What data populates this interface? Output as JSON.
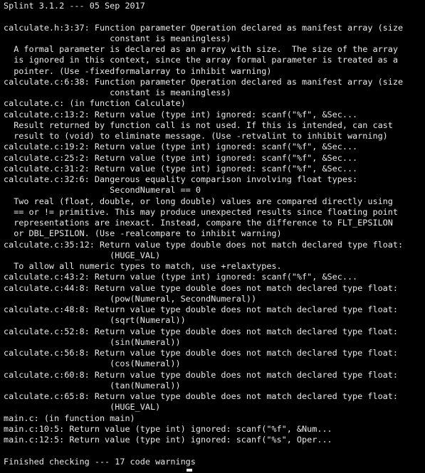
{
  "terminal": {
    "text_color": "#e8e8e8",
    "background_color": "#000000",
    "lines": [
      "Splint 3.1.2 --- 05 Sep 2017",
      "",
      "calculate.h:3:37: Function parameter Operation declared as manifest array (size",
      "                     constant is meaningless)",
      "  A formal parameter is declared as an array with size.  The size of the array",
      "  is ignored in this context, since the array formal parameter is treated as a",
      "  pointer. (Use -fixedformalarray to inhibit warning)",
      "calculate.c:6:38: Function parameter Operation declared as manifest array (size",
      "                     constant is meaningless)",
      "calculate.c: (in function Calculate)",
      "calculate.c:13:2: Return value (type int) ignored: scanf(\"%f\", &Sec...",
      "  Result returned by function call is not used. If this is intended, can cast",
      "  result to (void) to eliminate message. (Use -retvalint to inhibit warning)",
      "calculate.c:19:2: Return value (type int) ignored: scanf(\"%f\", &Sec...",
      "calculate.c:25:2: Return value (type int) ignored: scanf(\"%f\", &Sec...",
      "calculate.c:31:2: Return value (type int) ignored: scanf(\"%f\", &Sec...",
      "calculate.c:32:6: Dangerous equality comparison involving float types:",
      "                     SecondNumeral == 0",
      "  Two real (float, double, or long double) values are compared directly using",
      "  == or != primitive. This may produce unexpected results since floating point",
      "  representations are inexact. Instead, compare the difference to FLT_EPSILON",
      "  or DBL_EPSILON. (Use -realcompare to inhibit warning)",
      "calculate.c:35:12: Return value type double does not match declared type float:",
      "                     (HUGE_VAL)",
      "  To allow all numeric types to match, use +relaxtypes.",
      "calculate.c:43:2: Return value (type int) ignored: scanf(\"%f\", &Sec...",
      "calculate.c:44:8: Return value type double does not match declared type float:",
      "                     (pow(Numeral, SecondNumeral))",
      "calculate.c:48:8: Return value type double does not match declared type float:",
      "                     (sqrt(Numeral))",
      "calculate.c:52:8: Return value type double does not match declared type float:",
      "                     (sin(Numeral))",
      "calculate.c:56:8: Return value type double does not match declared type float:",
      "                     (cos(Numeral))",
      "calculate.c:60:8: Return value type double does not match declared type float:",
      "                     (tan(Numeral))",
      "calculate.c:65:8: Return value type double does not match declared type float:",
      "                     (HUGE_VAL)",
      "main.c: (in function main)",
      "main.c:10:5: Return value (type int) ignored: scanf(\"%f\", &Num...",
      "main.c:12:5: Return value (type int) ignored: scanf(\"%s\", Oper...",
      "",
      "Finished checking --- 17 code warnings"
    ]
  }
}
